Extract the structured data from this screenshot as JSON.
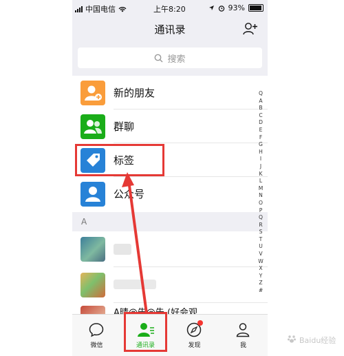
{
  "status_bar": {
    "carrier": "中国电信",
    "time": "上午8:20",
    "battery": "93%",
    "battery_level": 0.93
  },
  "nav": {
    "title": "通讯录"
  },
  "search": {
    "placeholder": "搜索"
  },
  "list": [
    {
      "label": "新的朋友",
      "icon": "new-friend-icon",
      "color": "#fa9d3b"
    },
    {
      "label": "群聊",
      "icon": "group-chat-icon",
      "color": "#1aad19"
    },
    {
      "label": "标签",
      "icon": "tag-icon",
      "color": "#2782d7"
    },
    {
      "label": "公众号",
      "icon": "official-account-icon",
      "color": "#2782d7"
    }
  ],
  "section_header": "A",
  "contacts": [
    {
      "label": ""
    },
    {
      "label": ""
    },
    {
      "label": "A晴@告@告  (好会观"
    }
  ],
  "index_letters": [
    "Q",
    "A",
    "B",
    "C",
    "D",
    "E",
    "F",
    "G",
    "H",
    "I",
    "J",
    "K",
    "L",
    "M",
    "N",
    "O",
    "P",
    "Q",
    "R",
    "S",
    "T",
    "U",
    "V",
    "W",
    "X",
    "Y",
    "Z",
    "#"
  ],
  "tabs": [
    {
      "label": "微信",
      "icon": "chat-bubble-icon"
    },
    {
      "label": "通讯录",
      "icon": "contacts-icon"
    },
    {
      "label": "发现",
      "icon": "compass-icon"
    },
    {
      "label": "我",
      "icon": "person-icon"
    }
  ],
  "colors": {
    "accent": "#1aad19",
    "annotation": "#e53935",
    "badge": "#f43530"
  },
  "watermark": "Baidu经验"
}
